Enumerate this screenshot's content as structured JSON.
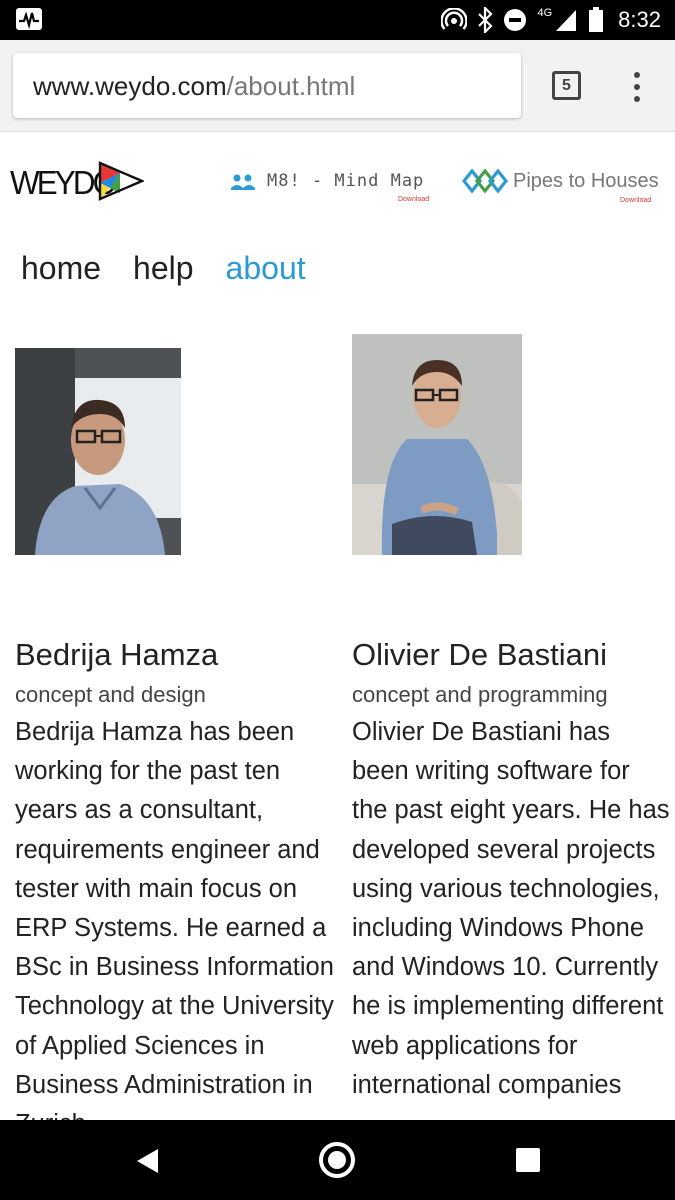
{
  "status_bar": {
    "time": "8:32",
    "network_label": "4G",
    "icons": [
      "activity-monitor-icon",
      "hotspot-icon",
      "bluetooth-icon",
      "do-not-disturb-icon",
      "signal-icon",
      "battery-icon"
    ]
  },
  "browser": {
    "url_domain": "www.weydo.com",
    "url_path": "/about.html",
    "tab_count": "5"
  },
  "site": {
    "logo_text": "WEYDO",
    "apps": [
      {
        "name": "M8! - Mind Map",
        "download_label": "Download",
        "icon": "m8-people-icon"
      },
      {
        "name": "Pipes to Houses",
        "download_label": "Download",
        "icon": "pipes-icon"
      }
    ],
    "nav": [
      {
        "label": "home",
        "active": false
      },
      {
        "label": "help",
        "active": false
      },
      {
        "label": "about",
        "active": true
      }
    ],
    "people": [
      {
        "name": "Bedrija Hamza",
        "role": "concept and design",
        "bio": "Bedrija Hamza has been working for the past ten years as a consultant, requirements engineer and tester with main focus on ERP Systems. He earned a BSc in Business Information Technology at the University of Applied Sciences in Business Administration in Zurich"
      },
      {
        "name": "Olivier De Bastiani",
        "role": "concept and programming",
        "bio": "Olivier De Bastiani has been writing software for the past eight years. He has developed several projects using various technologies, including Windows Phone and Windows 10. Currently he is implementing different web applications for international companies"
      }
    ]
  },
  "colors": {
    "accent": "#2a9ad4",
    "download_red": "#d83a2f",
    "logo_triangle": [
      "#e53935",
      "#43a047",
      "#1e88e5",
      "#fdd835",
      "#8e24aa"
    ]
  }
}
